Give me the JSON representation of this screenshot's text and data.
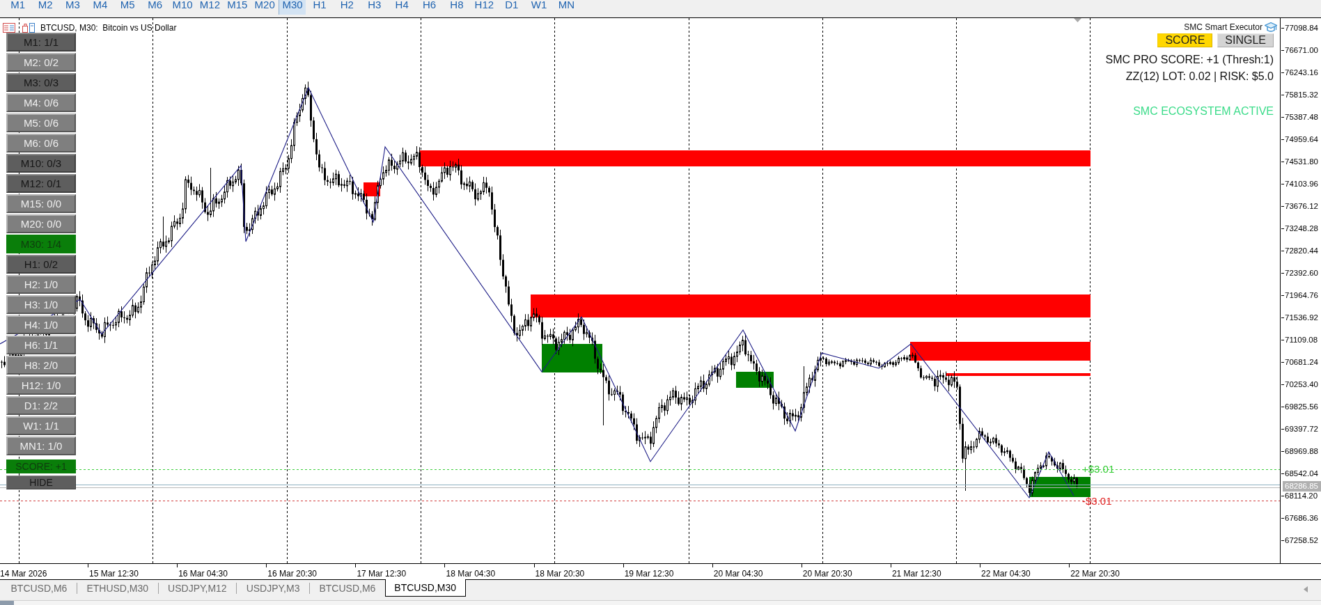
{
  "timeframe_bar": {
    "items": [
      {
        "label": "M1",
        "selected": false
      },
      {
        "label": "M2",
        "selected": false
      },
      {
        "label": "M3",
        "selected": false
      },
      {
        "label": "M4",
        "selected": false
      },
      {
        "label": "M5",
        "selected": false
      },
      {
        "label": "M6",
        "selected": false
      },
      {
        "label": "M10",
        "selected": false
      },
      {
        "label": "M12",
        "selected": false
      },
      {
        "label": "M15",
        "selected": false
      },
      {
        "label": "M20",
        "selected": false
      },
      {
        "label": "M30",
        "selected": true
      },
      {
        "label": "H1",
        "selected": false
      },
      {
        "label": "H2",
        "selected": false
      },
      {
        "label": "H3",
        "selected": false
      },
      {
        "label": "H4",
        "selected": false
      },
      {
        "label": "H6",
        "selected": false
      },
      {
        "label": "H8",
        "selected": false
      },
      {
        "label": "H12",
        "selected": false
      },
      {
        "label": "D1",
        "selected": false
      },
      {
        "label": "W1",
        "selected": false
      },
      {
        "label": "MN",
        "selected": false
      }
    ]
  },
  "chart": {
    "title": "BTCUSD, M30:  Bitcoin vs US Dollar",
    "timeframe_panel": {
      "buttons": [
        {
          "label": "M1: 1/1",
          "kind": "dark"
        },
        {
          "label": "M2: 0/2",
          "kind": "light"
        },
        {
          "label": "M3: 0/3",
          "kind": "dark"
        },
        {
          "label": "M4: 0/6",
          "kind": "light"
        },
        {
          "label": "M5: 0/6",
          "kind": "light"
        },
        {
          "label": "M6: 0/6",
          "kind": "light"
        },
        {
          "label": "M10: 0/3",
          "kind": "dark"
        },
        {
          "label": "M12: 0/1",
          "kind": "dark"
        },
        {
          "label": "M15: 0/0",
          "kind": "light"
        },
        {
          "label": "M20: 0/0",
          "kind": "light"
        },
        {
          "label": "M30: 1/4",
          "kind": "current"
        },
        {
          "label": "H1: 0/2",
          "kind": "dark"
        },
        {
          "label": "H2: 1/0",
          "kind": "light"
        },
        {
          "label": "H3: 1/0",
          "kind": "light"
        },
        {
          "label": "H4: 1/0",
          "kind": "light"
        },
        {
          "label": "H6: 1/1",
          "kind": "light"
        },
        {
          "label": "H8: 2/0",
          "kind": "light"
        },
        {
          "label": "H12: 1/0",
          "kind": "light"
        },
        {
          "label": "D1: 2/2",
          "kind": "light"
        },
        {
          "label": "W1: 1/1",
          "kind": "light"
        },
        {
          "label": "MN1: 1/0",
          "kind": "light"
        }
      ],
      "score": "SCORE: +1",
      "hide": "HIDE"
    },
    "executor_panel": {
      "title": "SMC Smart Executor",
      "mode_buttons": [
        {
          "label": "SCORE",
          "selected": true
        },
        {
          "label": "SINGLE",
          "selected": false
        }
      ],
      "score_line": "SMC PRO SCORE: +1 (Thresh:1)",
      "risk_line": "ZZ(12) LOT: 0.02 | RISK: $5.0",
      "status": "SMC ECOSYSTEM ACTIVE"
    },
    "take_profit_label": "+$3.01",
    "stop_loss_label": "-$3.01",
    "price_axis": {
      "labels": [
        "77098.84",
        "76671.00",
        "76243.16",
        "75815.32",
        "75387.48",
        "74959.64",
        "74531.80",
        "74103.96",
        "73676.12",
        "73248.28",
        "72820.44",
        "72392.60",
        "71964.76",
        "71536.92",
        "71109.08",
        "70681.24",
        "70253.40",
        "69825.56",
        "69397.72",
        "68969.88",
        "68542.04",
        "68114.20",
        "67686.36",
        "67258.52"
      ],
      "current_price": "68286.85"
    },
    "time_axis": {
      "labels": [
        "14 Mar 2026",
        "15 Mar 12:30",
        "16 Mar 04:30",
        "16 Mar 20:30",
        "17 Mar 12:30",
        "18 Mar 04:30",
        "18 Mar 20:30",
        "19 Mar 12:30",
        "20 Mar 04:30",
        "20 Mar 20:30",
        "21 Mar 12:30",
        "22 Mar 04:30",
        "22 Mar 20:30"
      ]
    }
  },
  "tabs": [
    {
      "label": "BTCUSD,M6",
      "selected": false
    },
    {
      "label": "ETHUSD,M30",
      "selected": false
    },
    {
      "label": "USDJPY,M12",
      "selected": false
    },
    {
      "label": "USDJPY,M3",
      "selected": false
    },
    {
      "label": "BTCUSD,M6",
      "selected": false
    },
    {
      "label": "BTCUSD,M30",
      "selected": true
    }
  ]
}
